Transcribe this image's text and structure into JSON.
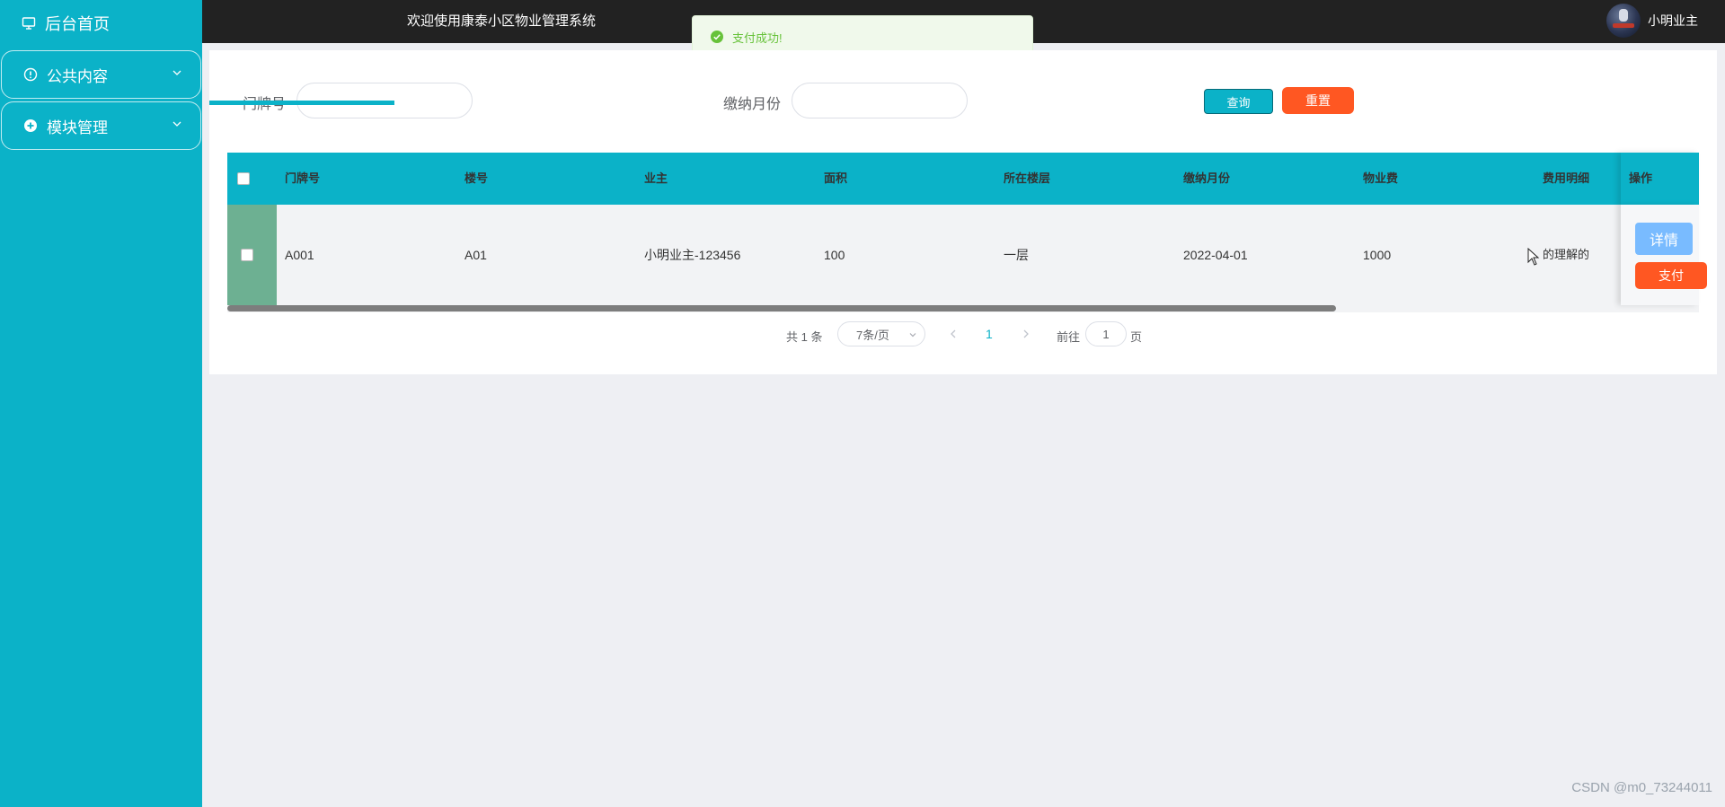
{
  "sidebar": {
    "home_label": "后台首页",
    "menus": [
      {
        "label": "公共内容",
        "icon": "info-circle-icon"
      },
      {
        "label": "模块管理",
        "icon": "plus-circle-icon"
      }
    ]
  },
  "header": {
    "welcome": "欢迎使用康泰小区物业管理系统",
    "username": "小明业主"
  },
  "toast": {
    "message": "支付成功!",
    "status": "success"
  },
  "filters": {
    "door_label": "门牌号",
    "door_value": "",
    "month_label": "缴纳月份",
    "month_value": "",
    "query_button": "查询",
    "reset_button": "重置"
  },
  "table": {
    "columns": [
      "门牌号",
      "楼号",
      "业主",
      "面积",
      "所在楼层",
      "缴纳月份",
      "物业费",
      "费用明细",
      "操作"
    ],
    "rows": [
      {
        "door": "A001",
        "building": "A01",
        "owner": "小明业主-123456",
        "area": "100",
        "floor": "一层",
        "month": "2022-04-01",
        "fee": "1000",
        "detail": "的理解的"
      }
    ],
    "actions": {
      "detail": "详情",
      "pay": "支付"
    }
  },
  "pagination": {
    "total": "共 1 条",
    "page_size": "7条/页",
    "current_page": "1",
    "goto_label": "前往",
    "goto_value": "1",
    "page_suffix": "页"
  },
  "watermark": "CSDN @m0_73244011",
  "colors": {
    "primary": "#0bb2c8",
    "danger": "#ff5722",
    "success": "#67c23a",
    "header": "#222222"
  }
}
